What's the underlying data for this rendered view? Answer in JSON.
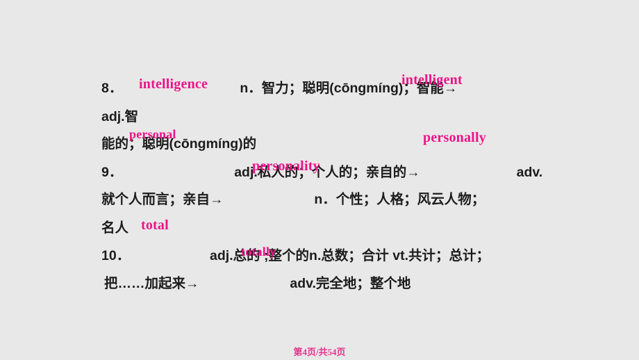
{
  "slide": {
    "background_color": "#e9e8e8",
    "text_color": "#1c1c1c",
    "answer_color": "#ee1289",
    "footer_color": "#e8328f"
  },
  "entries": [
    {
      "number": "8．",
      "headword": "intelligence",
      "definition_part1": "n．智力；聪明(cōngmíng)；智能→",
      "definition_part2": "adj.智",
      "definition_part3": "能的；聪明(cōngmíng)的"
    },
    {
      "number": "9．",
      "definition_part1": "adj.私人的；个人的；亲自的→",
      "definition_part2": "adv.就个人而言；亲自→",
      "definition_part3": "n．个性；人格；风云人物；名人"
    },
    {
      "number": "10．",
      "definition_part1": "adj.总的 ;整个的n.总数；合计 vt.共计；总计；",
      "definition_part2": "把……加起来→",
      "definition_part3": "adv.完全地；整个地"
    }
  ],
  "lines": {
    "l1_num": "8．",
    "l1_headword": "intelligence",
    "l1_def": "n．智力；聪明(cōngmíng)；智能→",
    "l2_text": "adj.智",
    "l3_text": "能的；聪明(cōngmíng)的",
    "l4_num": "9．",
    "l4_def_a": "adj.私人的；个人的；亲自的→",
    "l4_def_b": "adv.",
    "l5_def_a": "就个人而言；亲自→",
    "l5_def_b": "n．个性；人格；风云人物；",
    "l6_text": "名人",
    "l7_num": "10．",
    "l7_def_a": "adj.总的 ;整个的n.总数；合计 vt.共计；总计；",
    "l8_def_a": "把……加起来→",
    "l8_def_b": "adv.完全地；整个地"
  },
  "answers": [
    {
      "id": "intelligence",
      "text": "intelligence"
    },
    {
      "id": "intelligent",
      "text": "intelligent"
    },
    {
      "id": "personal-1",
      "text": "personal"
    },
    {
      "id": "personally",
      "text": "personally"
    },
    {
      "id": "personality",
      "text": "personality"
    },
    {
      "id": "total",
      "text": "total"
    },
    {
      "id": "totally",
      "text": "totally"
    }
  ],
  "footer": {
    "page_label": "第4页/共54页"
  }
}
